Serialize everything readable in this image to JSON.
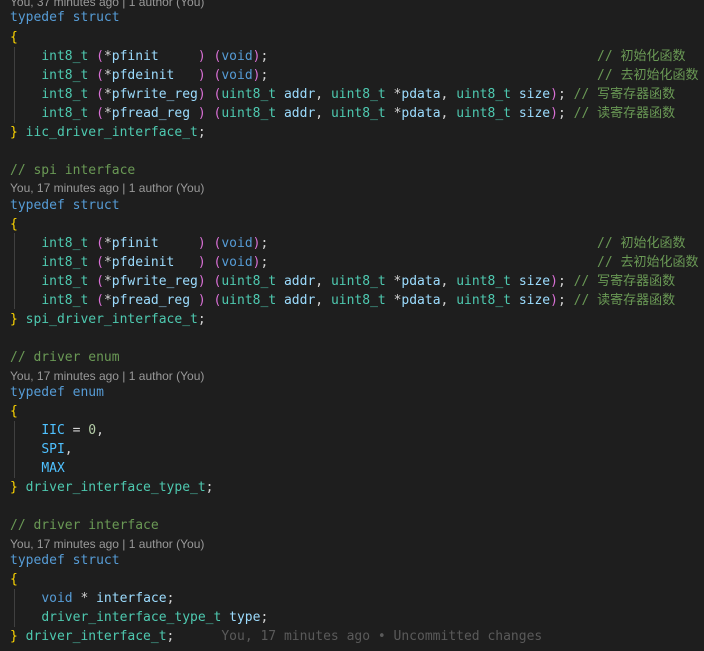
{
  "code_lens_top": "You, 37 minutes ago | 1 author (You)",
  "code_lens": "You, 17 minutes ago | 1 author (You)",
  "tokens": {
    "typedef": "typedef",
    "struct": "struct",
    "enum": "enum",
    "int8_t": "int8_t",
    "uint8_t": "uint8_t",
    "void_kw": "void",
    "pfinit": "pfinit",
    "pfdeinit": "pfdeinit",
    "pfwrite_reg": "pfwrite_reg",
    "pfread_reg": "pfread_reg",
    "addr": "addr",
    "pdata": "pdata",
    "size": "size",
    "interface_var": "interface",
    "type_var": "type"
  },
  "comments": {
    "init": "// 初始化函数",
    "deinit": "// 去初始化函数",
    "write": "// 写寄存器函数",
    "read": "// 读寄存器函数",
    "spi": "// spi interface",
    "enum": "// driver enum",
    "driver": "// driver interface"
  },
  "typenames": {
    "iic": "iic_driver_interface_t",
    "spi": "spi_driver_interface_t",
    "type": "driver_interface_type_t",
    "driver": "driver_interface_t"
  },
  "enum_values": [
    "IIC",
    "SPI",
    "MAX"
  ],
  "enum_init": "0",
  "blame_inline": "You, 17 minutes ago • Uncommitted changes",
  "colors": {
    "background": "#1e1e1e",
    "keyword": "#569cd6",
    "type": "#4ec9b0",
    "variable": "#9cdcfe",
    "comment": "#6a9955",
    "number": "#b5cea8",
    "constant": "#4fc1ff",
    "bracket_level1": "#ffd700",
    "bracket_level2": "#da70d6"
  }
}
